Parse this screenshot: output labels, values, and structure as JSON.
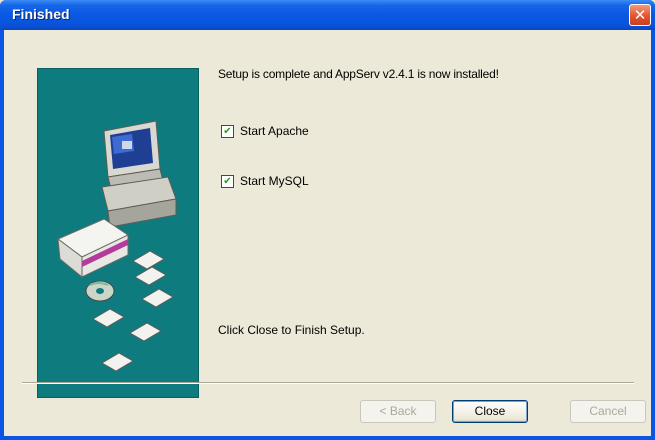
{
  "window": {
    "title": "Finished",
    "close_glyph": "✕"
  },
  "message": "Setup is complete and AppServ v2.4.1 is now installed!",
  "options": [
    {
      "label": "Start Apache",
      "checked": true,
      "check_glyph": "✔"
    },
    {
      "label": "Start MySQL",
      "checked": true,
      "check_glyph": "✔"
    }
  ],
  "finish_hint": "Click Close to Finish Setup.",
  "buttons": {
    "back": "< Back",
    "close": "Close",
    "cancel": "Cancel"
  },
  "colors": {
    "titlebar": "#0a58e4",
    "art_background": "#0e7b7e",
    "dialog_background": "#ece9d8"
  },
  "icons": [
    "computer-icon",
    "software-box-icon",
    "cd-disc-icon",
    "document-icons"
  ]
}
